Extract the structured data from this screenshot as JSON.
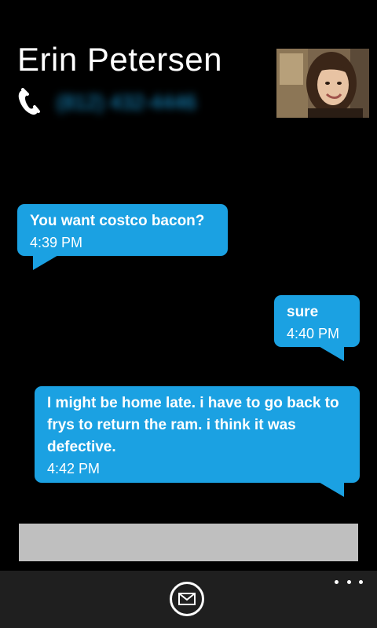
{
  "contact": {
    "name": "Erin Petersen",
    "phone_number": "(812) 432-4446",
    "phone_icon": "phone-icon",
    "avatar_icon": "contact-photo"
  },
  "messages": [
    {
      "direction": "received",
      "text": "You want costco bacon?",
      "time": "4:39 PM"
    },
    {
      "direction": "sent",
      "text": "sure",
      "time": "4:40 PM"
    },
    {
      "direction": "sent",
      "text": "I might be home late. i have to go back to frys to return the ram. i think it was defective.",
      "time": "4:42 PM"
    }
  ],
  "compose": {
    "value": "",
    "placeholder": ""
  },
  "app_bar": {
    "send_icon": "envelope-icon",
    "more_icon": "ellipsis-icon"
  },
  "colors": {
    "background": "#000000",
    "accent": "#1ba1e2",
    "input": "#bfbfbf",
    "app_bar": "#1f1f1f"
  }
}
